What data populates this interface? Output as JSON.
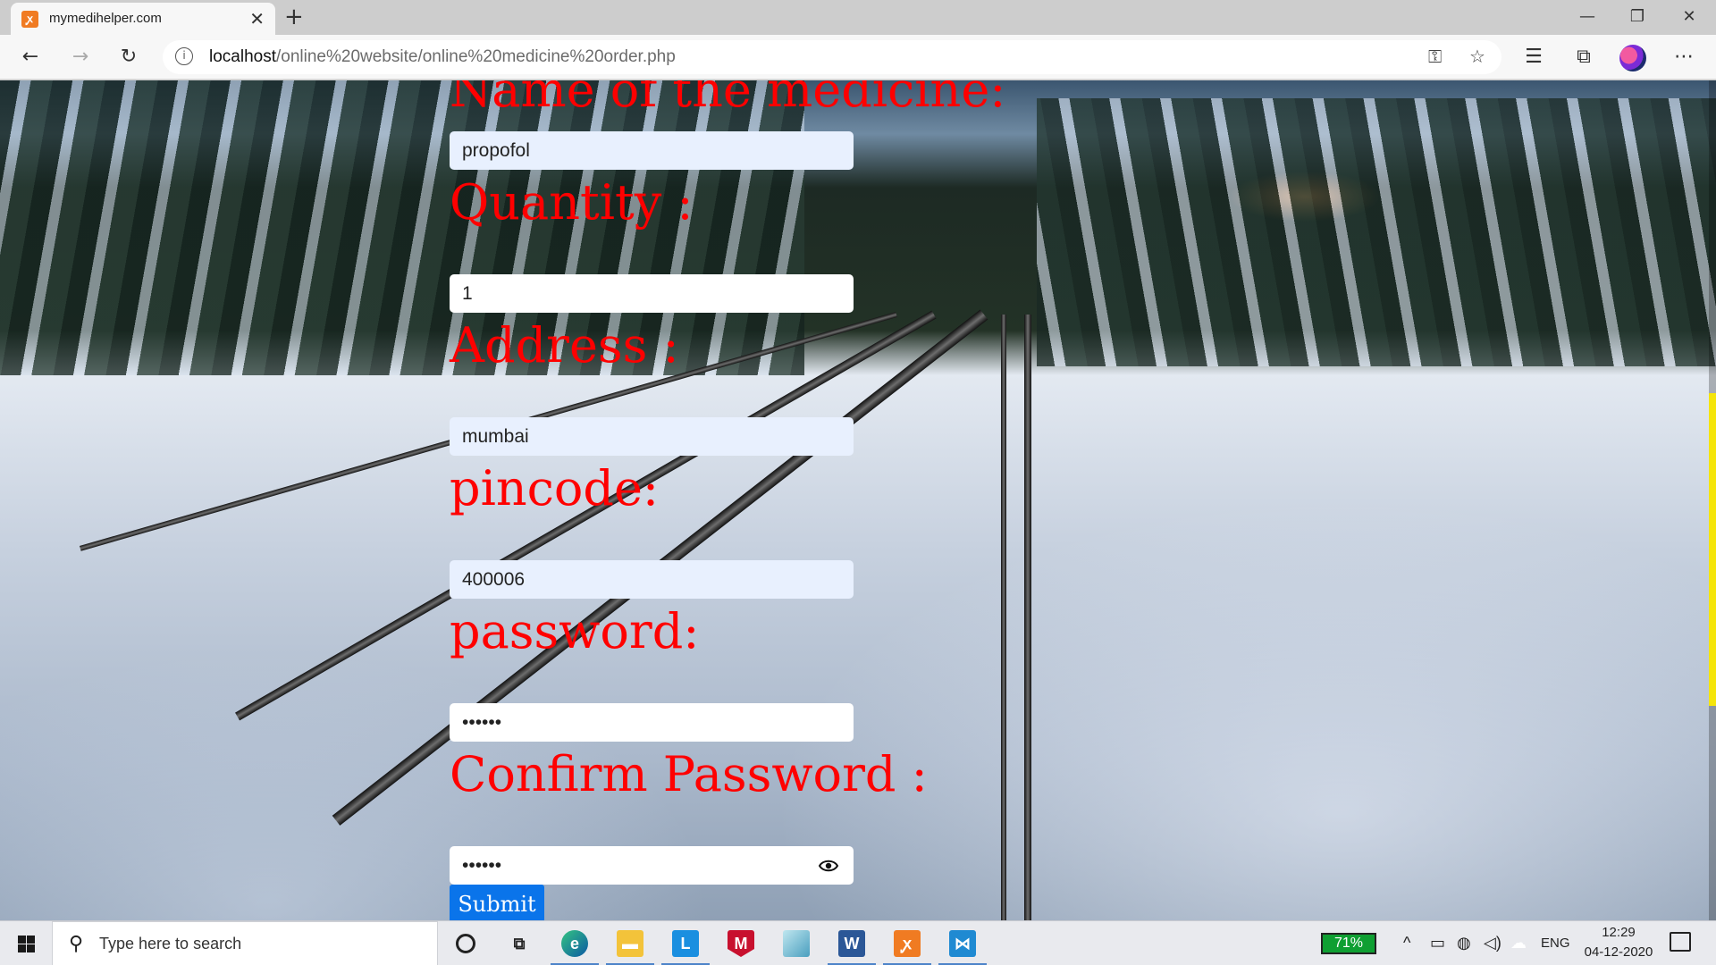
{
  "browser": {
    "tab_title": "mymedihelper.com",
    "url_host": "localhost",
    "url_path": "/online%20website/online%20medicine%20order.php",
    "new_tab_icon": "plus-icon",
    "window_controls": [
      "minimize-icon",
      "restore-icon",
      "close-icon"
    ]
  },
  "form": {
    "fields": [
      {
        "label": "Name of the medicine:",
        "value": "propofol"
      },
      {
        "label": "Quantity :",
        "value": "1"
      },
      {
        "label": "Address :",
        "value": "mumbai"
      },
      {
        "label": "pincode:",
        "value": "400006"
      },
      {
        "label": "password:",
        "value": "••••••"
      },
      {
        "label": "Confirm Password :",
        "value": "••••••"
      }
    ],
    "submit_label": "Submit",
    "label_color": "#ff0000",
    "submit_color": "#0a74ea"
  },
  "taskbar": {
    "search_placeholder": "Type here to search",
    "apps": [
      "cortana-icon",
      "task-view-icon",
      "edge-icon",
      "file-explorer-icon",
      "l-app-icon",
      "mcafee-icon",
      "notepad-icon",
      "word-icon",
      "xampp-icon",
      "vscode-icon"
    ],
    "battery_percent": "71%",
    "language": "ENG",
    "time": "12:29",
    "date": "04-12-2020"
  }
}
